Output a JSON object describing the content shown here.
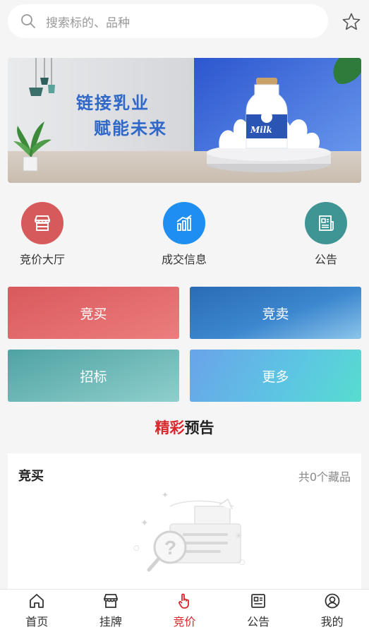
{
  "search": {
    "placeholder": "搜索标的、品种"
  },
  "banner": {
    "line1": "链接乳业",
    "line2": "赋能未来",
    "bottle_label": "Milk"
  },
  "quick_links": [
    {
      "label": "竞价大厅",
      "icon": "store-icon",
      "color": "#d65a5b"
    },
    {
      "label": "成交信息",
      "icon": "bar-chart-icon",
      "color": "#1e8ef2"
    },
    {
      "label": "公告",
      "icon": "document-icon",
      "color": "#3f9594"
    }
  ],
  "tiles": [
    {
      "label": "竞买"
    },
    {
      "label": "竞卖"
    },
    {
      "label": "招标"
    },
    {
      "label": "更多"
    }
  ],
  "section": {
    "title_accent": "精彩",
    "title_rest": "预告"
  },
  "card": {
    "title": "竞买",
    "count_text": "共0个藏品"
  },
  "tabbar": {
    "active_color": "#d8262b",
    "items": [
      {
        "label": "首页",
        "icon": "home-icon"
      },
      {
        "label": "挂牌",
        "icon": "shop-icon"
      },
      {
        "label": "竞价",
        "icon": "hand-pointer-icon"
      },
      {
        "label": "公告",
        "icon": "notice-icon"
      },
      {
        "label": "我的",
        "icon": "user-icon"
      }
    ]
  }
}
